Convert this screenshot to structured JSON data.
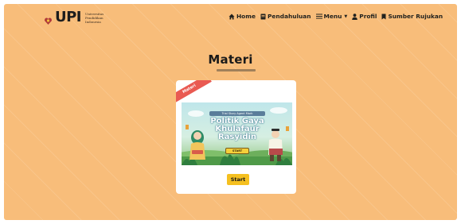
{
  "brand": {
    "logo_text": "UPI",
    "logo_subtext": "Universitas Pendidikan Indonesia"
  },
  "nav": {
    "items": [
      {
        "label": "Home",
        "icon": "home-icon"
      },
      {
        "label": "Pendahuluan",
        "icon": "book-icon"
      },
      {
        "label": "Menu",
        "icon": "menu-icon"
      },
      {
        "label": "Profil",
        "icon": "user-icon"
      },
      {
        "label": "Sumber Rujukan",
        "icon": "bookmark-icon"
      }
    ]
  },
  "page": {
    "heading": "Materi"
  },
  "card": {
    "ribbon": "Materi",
    "thumbnail": {
      "top_line": "Trial Story Agent Mark",
      "title": "Politik Gaya Khulafaur Rasyidin",
      "start_label": "START"
    },
    "button_label": "Start"
  },
  "colors": {
    "background": "#f8bd7a",
    "accent": "#f5c020",
    "ribbon": "#e95a52",
    "card": "#ffffff"
  }
}
